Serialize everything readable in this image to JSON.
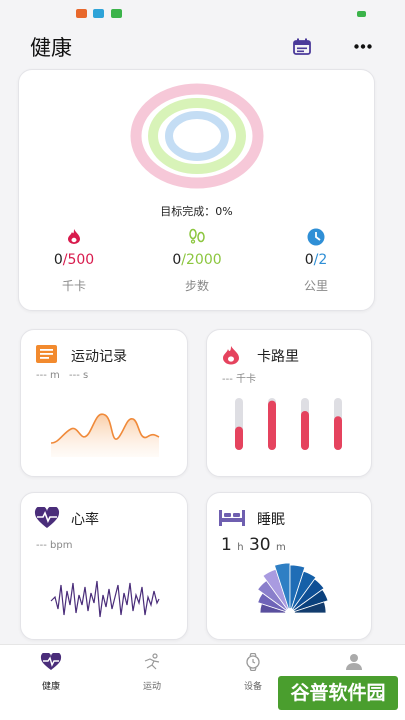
{
  "app": {
    "title": "健康"
  },
  "summary": {
    "goal_label": "目标完成：",
    "goal_value": "0%",
    "stats": [
      {
        "current": "0",
        "target": "/500",
        "unit": "千卡",
        "color": "#d81b4d",
        "icon": "flame-icon"
      },
      {
        "current": "0",
        "target": "/2000",
        "unit": "步数",
        "color": "#8cc63f",
        "icon": "footprints-icon"
      },
      {
        "current": "0",
        "target": "/2",
        "unit": "公里",
        "color": "#2f8fd6",
        "icon": "clock-icon"
      }
    ],
    "rings": {
      "outer": "#f6c8d8",
      "middle": "#d8f3b8",
      "inner": "#c4ddf4"
    }
  },
  "cards": {
    "exercise": {
      "title": "运动记录",
      "sub1": "--- m",
      "sub2": "--- s",
      "icon": "list-icon",
      "color": "#f28a2e"
    },
    "calories": {
      "title": "卡路里",
      "sub": "--- 千卡",
      "icon": "flame-icon",
      "color": "#e5435e",
      "bars": [
        0.45,
        0.95,
        0.75,
        0.65
      ]
    },
    "heart": {
      "title": "心率",
      "sub": "--- bpm",
      "icon": "heart-pulse-icon",
      "color": "#4a2d7a"
    },
    "sleep": {
      "title": "睡眠",
      "hours": "1",
      "h_unit": "h",
      "minutes": "30",
      "m_unit": "m",
      "icon": "bed-icon",
      "color": "#6f5fb0"
    }
  },
  "tabs": [
    {
      "label": "健康",
      "icon": "heart-pulse-icon",
      "active": true
    },
    {
      "label": "运动",
      "icon": "runner-icon",
      "active": false
    },
    {
      "label": "设备",
      "icon": "watch-icon",
      "active": false
    },
    {
      "label": "",
      "icon": "person-icon",
      "active": false
    }
  ],
  "watermark": "谷普软件园"
}
